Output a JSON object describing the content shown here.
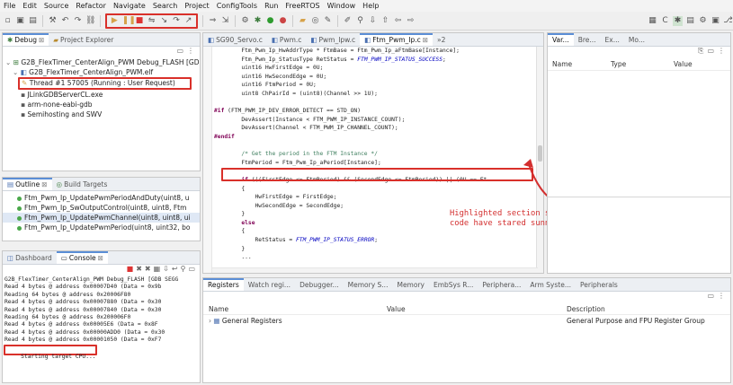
{
  "menu": [
    "File",
    "Edit",
    "Source",
    "Refactor",
    "Navigate",
    "Search",
    "Project",
    "ConfigTools",
    "Run",
    "FreeRTOS",
    "Window",
    "Help"
  ],
  "debug_panel": {
    "tabs": [
      "Debug",
      "Project Explorer"
    ],
    "launch": "G2B_FlexTimer_CenterAlign_PWM Debug_FLASH [GDB",
    "elf": "G2B_FlexTimer_CenterAlign_PWM.elf",
    "thread": "Thread #1 57005 (Running : User Request)",
    "items": [
      "JLinkGDBServerCL.exe",
      "arm-none-eabi-gdb",
      "Semihosting and SWV"
    ]
  },
  "outline_panel": {
    "tabs": [
      "Outline",
      "Build Targets"
    ],
    "items": [
      "Ftm_Pwm_Ip_UpdatePwmPeriodAndDuty(uint8, u",
      "Ftm_Pwm_Ip_SwOutputControl(uint8, uint8, Ftm",
      "Ftm_Pwm_Ip_UpdatePwmChannel(uint8, uint8, ui",
      "Ftm_Pwm_Ip_UpdatePwmPeriod(uint8, uint32, bo"
    ]
  },
  "console_panel": {
    "tabs": [
      "Dashboard",
      "Console"
    ],
    "header": "G2B_FlexTimer_CenterAlign_PWM Debug_FLASH [GDB SEGG",
    "lines": [
      "Read 4 bytes @ address 0x00007D40 (Data = 0x9b",
      "Reading 64 bytes @ address 0x20006F80",
      "Read 4 bytes @ address 0x00007880 (Data = 0x30",
      "Read 4 bytes @ address 0x00007840 (Data = 0x30",
      "Reading 64 bytes @ address 0x200006F0",
      "Read 4 bytes @ address 0x00005E6 (Data = 0x8F",
      "Read 4 bytes @ address 0x00000ADD0 (Data = 0x30",
      "Read 4 bytes @ address 0x00001050 (Data = 0xF7"
    ],
    "status": "Starting target CPU..."
  },
  "editor": {
    "tabs": [
      "SG90_Servo.c",
      "Pwm.c",
      "Pwm_Ipw.c",
      "Ftm_Pwm_Ip.c",
      "»2"
    ],
    "active_tab_index": 3,
    "lines": [
      {
        "t": "        Ftm_Pwm_Ip_HwAddrType * FtmBase = Ftm_Pwm_Ip_aFtmBase[Instance];"
      },
      {
        "t": "        Ftm_Pwm_Ip_StatusType RetStatus = ",
        "it": "FTM_PWM_IP_STATUS_SUCCESS",
        "after": ";"
      },
      {
        "t": "        uint16 HwFirstEdge = 0U;"
      },
      {
        "t": "        uint16 HwSecondEdge = 0U;"
      },
      {
        "t": "        uint16 FtmPeriod = 0U;"
      },
      {
        "t": "        uint8 ChPairId = (uint8)(Channel >> 1U);"
      },
      {
        "t": ""
      },
      {
        "mac": "#if",
        "t": " (FTM_PWM_IP_DEV_ERROR_DETECT == STD_ON)"
      },
      {
        "t": "        DevAssert(Instance < FTM_PWM_IP_INSTANCE_COUNT);"
      },
      {
        "t": "        DevAssert(Channel < FTM_PWM_IP_CHANNEL_COUNT);"
      },
      {
        "mac": "#endif",
        "t": ""
      },
      {
        "t": ""
      },
      {
        "cm": "        /* Get the period in the FTM Instance */"
      },
      {
        "t": "        FtmPeriod = Ftm_Pwm_Ip_aPeriod[Instance];"
      },
      {
        "t": ""
      },
      {
        "kw": "        if",
        "t": " (((FirstEdge <= FtmPeriod) && (SecondEdge <= FtmPeriod)) || (0U == Ft"
      },
      {
        "t": "        {"
      },
      {
        "t": "            HwFirstEdge = FirstEdge;"
      },
      {
        "t": "            HwSecondEdge = SecondEdge;"
      },
      {
        "t": "        }"
      },
      {
        "kw": "        else",
        "t": ""
      },
      {
        "t": "        {"
      },
      {
        "t": "            RetStatus = ",
        "it": "FTM_PWM_IP_STATUS_ERROR",
        "after": ";"
      },
      {
        "t": "        }"
      },
      {
        "t": "        ..."
      }
    ]
  },
  "annotation": "Highlighted section shows from where\ncode have stared sunning",
  "variables_panel": {
    "tabs": [
      "Var...",
      "Bre...",
      "Ex...",
      "Mo..."
    ],
    "columns": [
      "Name",
      "Type",
      "Value"
    ]
  },
  "registers_panel": {
    "tabs": [
      "Registers",
      "Watch regi...",
      "Debugger...",
      "Memory S...",
      "Memory",
      "EmbSys R...",
      "Periphera...",
      "Arm Syste...",
      "Peripherals"
    ],
    "columns": [
      "Name",
      "Value",
      "Description"
    ],
    "rows": [
      {
        "name": "General Registers",
        "value": "",
        "description": "General Purpose and FPU Register Group"
      }
    ]
  },
  "colors": {
    "highlight_red": "#d9302a",
    "annotation_red": "#d32f2f",
    "accent_blue": "#5b8ed6"
  }
}
